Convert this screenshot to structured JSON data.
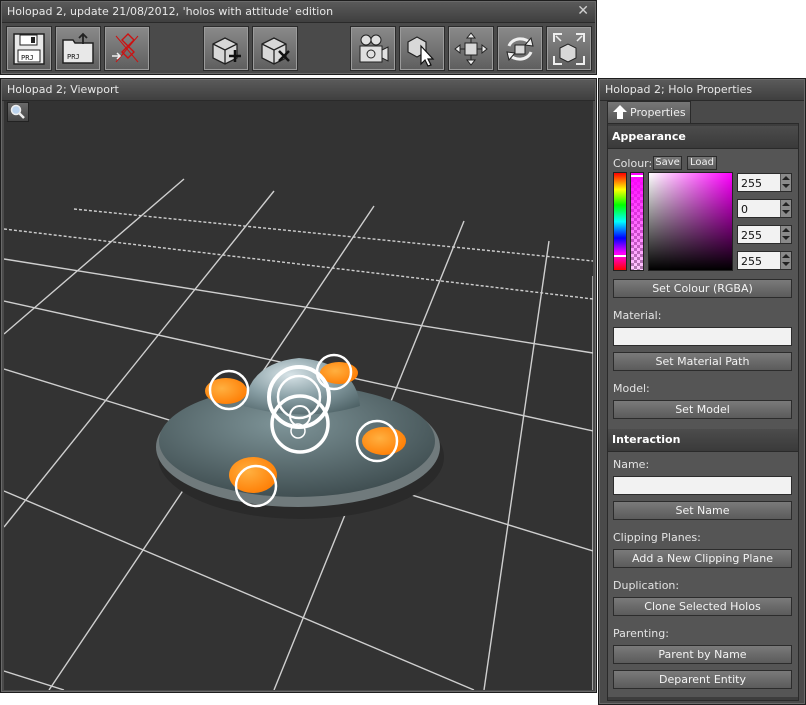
{
  "toolbar": {
    "title": "Holopad 2, update 21/08/2012, 'holos with attitude' edition",
    "close_glyph": "✕",
    "buttons": [
      {
        "icon": "save-project-icon"
      },
      {
        "icon": "open-project-icon"
      },
      {
        "icon": "export-icon"
      },
      {
        "icon": "add-holo-icon"
      },
      {
        "icon": "delete-holo-icon"
      },
      {
        "icon": "camera-icon"
      },
      {
        "icon": "select-cursor-icon"
      },
      {
        "icon": "move-icon"
      },
      {
        "icon": "rotate-icon"
      },
      {
        "icon": "scale-icon"
      }
    ],
    "prj_label": "PRJ"
  },
  "viewport": {
    "title": "Holopad 2; Viewport",
    "zoom_icon": "magnifier-icon"
  },
  "properties": {
    "title": "Holopad 2; Holo Properties",
    "tab_label": "Properties",
    "appearance": {
      "header": "Appearance",
      "colour_label": "Colour:",
      "save_label": "Save",
      "load_label": "Load",
      "rgba": [
        "255",
        "0",
        "255",
        "255"
      ],
      "set_colour_label": "Set Colour (RGBA)",
      "material_label": "Material:",
      "material_value": "",
      "set_material_label": "Set Material Path",
      "model_label": "Model:",
      "set_model_label": "Set Model"
    },
    "interaction": {
      "header": "Interaction",
      "name_label": "Name:",
      "name_value": "",
      "set_name_label": "Set Name",
      "clipping_label": "Clipping Planes:",
      "add_clip_label": "Add a New Clipping Plane",
      "duplication_label": "Duplication:",
      "clone_label": "Clone Selected Holos",
      "parenting_label": "Parenting:",
      "parent_label": "Parent by Name",
      "deparent_label": "Deparent Entity"
    }
  },
  "colors": {
    "selected_colour": "#ff00ff",
    "accent_orange": "#ff8a00"
  }
}
